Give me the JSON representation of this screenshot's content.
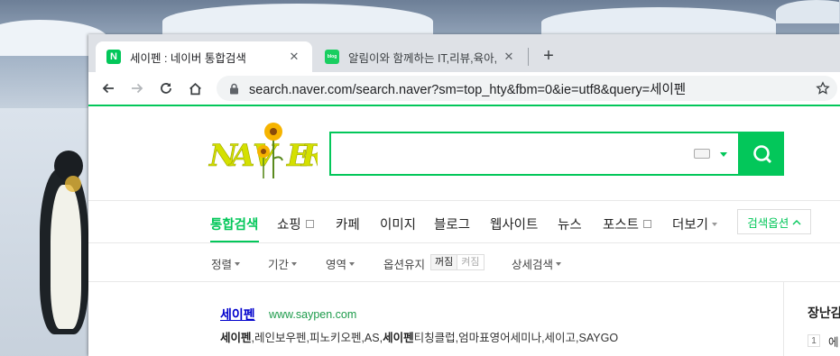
{
  "tabs": [
    {
      "title": "세이펜 : 네이버 통합검색",
      "favicon": "N"
    },
    {
      "title": "알림이와 함께하는 IT,리뷰,육아,",
      "favicon": "blog"
    }
  ],
  "toolbar": {
    "url": "search.naver.com/search.naver?sm=top_hty&fbm=0&ie=utf8&query=세이펜"
  },
  "search": {
    "value": ""
  },
  "lnb": [
    {
      "label": "통합검색",
      "active": true
    },
    {
      "label": "쇼핑"
    },
    {
      "label": "카페"
    },
    {
      "label": "이미지"
    },
    {
      "label": "블로그"
    },
    {
      "label": "웹사이트"
    },
    {
      "label": "뉴스"
    },
    {
      "label": "포스트"
    },
    {
      "label": "더보기"
    }
  ],
  "search_options_label": "검색옵션",
  "filters": {
    "sort": "정렬",
    "period": "기간",
    "area": "영역",
    "option_keep": "옵션유지",
    "toggle_off": "꺼짐",
    "toggle_on": "켜짐",
    "detail": "상세검색"
  },
  "result": {
    "title": "세이펜",
    "url": "www.saypen.com",
    "desc_b1": "세이펜",
    "desc_1": ",레인보우펜,피노키오펜,AS,",
    "desc_b2": "세이펜",
    "desc_2": "티칭클럽,엄마표영어세미나,세이고,SAYGO"
  },
  "side": {
    "title": "장난감",
    "num": "1",
    "text": "에"
  },
  "colors": {
    "naver_green": "#03c75a",
    "link_blue": "#0000cc",
    "url_green": "#1d9b4b"
  }
}
